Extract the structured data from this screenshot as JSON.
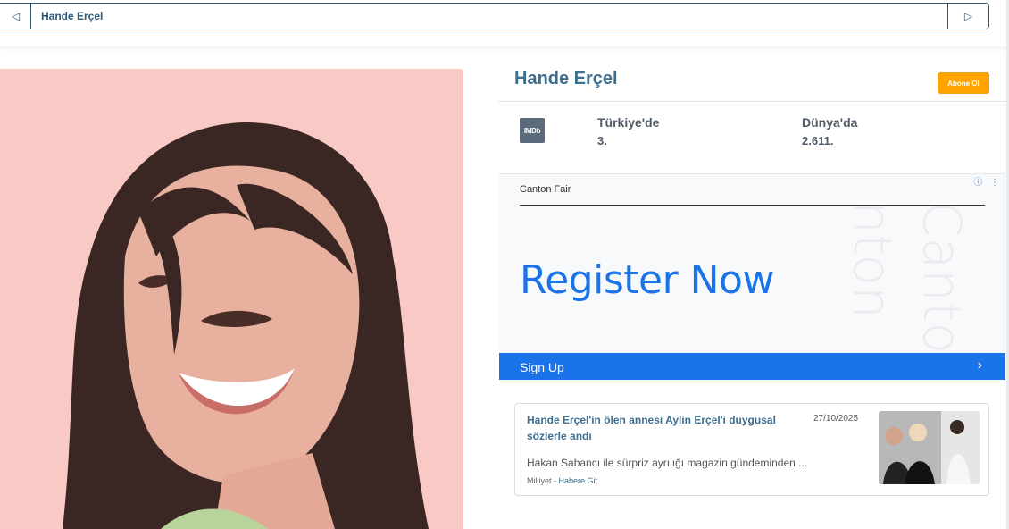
{
  "nav": {
    "prev_icon": "triangle-left-icon",
    "title": "Hande Erçel",
    "next_icon": "triangle-right-icon"
  },
  "profile": {
    "name": "Hande Erçel",
    "subscribe_label": "Abone Ol"
  },
  "ranking": {
    "imdb_label": "IMDb",
    "turkey_label": "Türkiye'de",
    "turkey_value": "3.",
    "world_label": "Dünya'da",
    "world_value": "2.611."
  },
  "ad": {
    "brand": "Canton Fair",
    "info_icon": "info-icon",
    "headline": "Register Now",
    "cta_label": "Sign Up",
    "background_text_1": "Canto",
    "background_text_2": "nton"
  },
  "news": {
    "title": "Hande Erçel'in ölen annesi Aylin Erçel'i duygusal sözlerle andı",
    "date": "27/10/2025",
    "excerpt": "Hakan Sabancı ile sürpriz ayrılığı magazin gündeminden ...",
    "source": "Milliyet",
    "link_label": "Habere Git"
  },
  "colors": {
    "accent": "#3e6e8e",
    "subscribe": "#ffa300",
    "ad_blue": "#1a73e8",
    "hero_bg": "#f8c9c5"
  }
}
